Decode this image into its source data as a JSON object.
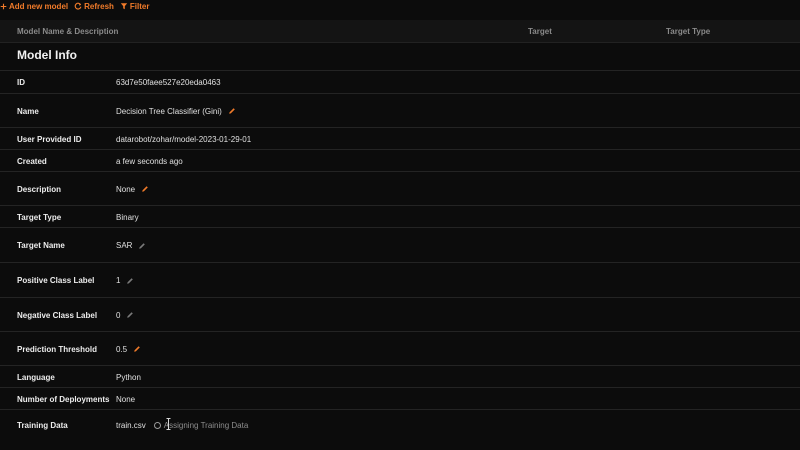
{
  "toolbar": {
    "add_label": "Add new model",
    "refresh_label": "Refresh",
    "filter_label": "Filter"
  },
  "table_header": {
    "name_col": "Model Name & Description",
    "target_col": "Target",
    "target_type_col": "Target Type"
  },
  "section": {
    "title": "Model Info"
  },
  "fields": {
    "id": {
      "label": "ID",
      "value": "63d7e50faee527e20eda0463"
    },
    "name": {
      "label": "Name",
      "value": "Decision Tree Classifier (Gini)"
    },
    "user_provided_id": {
      "label": "User Provided ID",
      "value": "datarobot/zohar/model-2023-01-29-01"
    },
    "created": {
      "label": "Created",
      "value": "a few seconds ago"
    },
    "description": {
      "label": "Description",
      "value": "None"
    },
    "target_type": {
      "label": "Target Type",
      "value": "Binary"
    },
    "target_name": {
      "label": "Target Name",
      "value": "SAR"
    },
    "positive_class_label": {
      "label": "Positive Class Label",
      "value": "1"
    },
    "negative_class_label": {
      "label": "Negative Class Label",
      "value": "0"
    },
    "prediction_threshold": {
      "label": "Prediction Threshold",
      "value": "0.5"
    },
    "language": {
      "label": "Language",
      "value": "Python"
    },
    "number_of_deployments": {
      "label": "Number of Deployments",
      "value": "None"
    },
    "training_data": {
      "label": "Training Data",
      "value": "train.csv",
      "status": "Assigning Training Data"
    }
  },
  "colors": {
    "accent": "#f17b2a",
    "background": "#0c0c0c",
    "muted_icon": "#8a8a8a"
  }
}
